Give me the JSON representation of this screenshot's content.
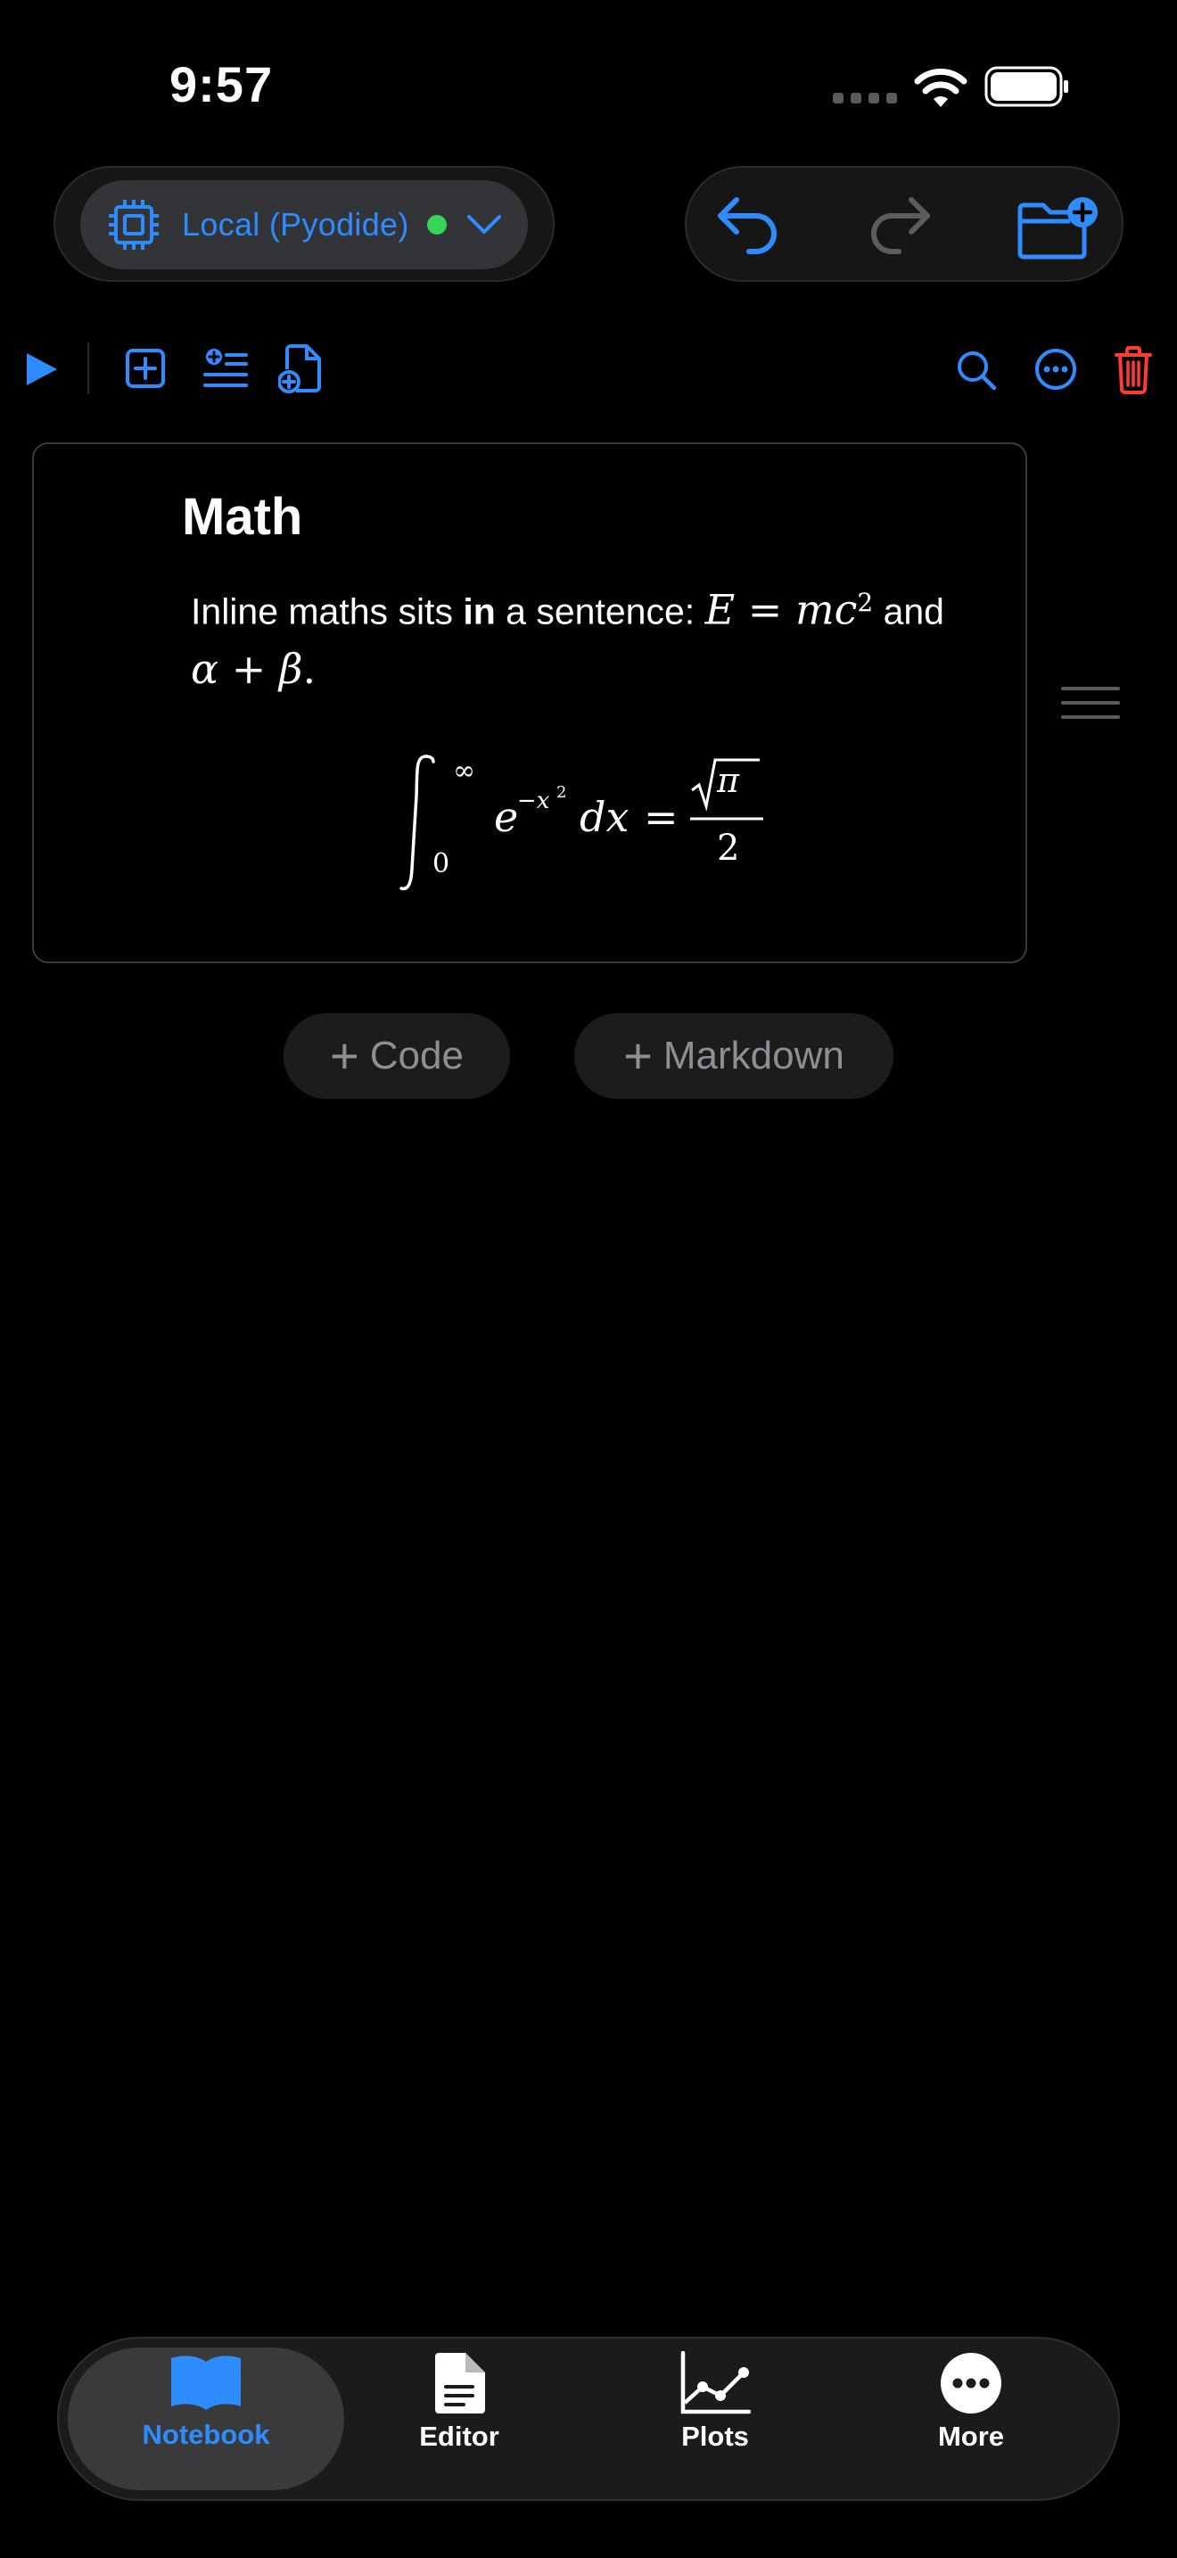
{
  "status_bar": {
    "time": "9:57"
  },
  "kernel": {
    "label": "Local (Pyodide)",
    "status_color": "#35d658"
  },
  "colors": {
    "accent": "#2f8cff",
    "danger": "#ff3b30",
    "disabled": "#5c5c5f"
  },
  "cell": {
    "title": "Math",
    "text_before": "Inline maths sits ",
    "text_bold": "in",
    "text_after": " a sentence: ",
    "formula_inline_1": "E = mc²",
    "text_and": " and",
    "formula_inline_2": "α + β.",
    "display_formula": "∫₀^∞ e^(−x²) dx = √π / 2"
  },
  "add_buttons": {
    "code": "Code",
    "markdown": "Markdown"
  },
  "tabs": [
    {
      "label": "Notebook",
      "icon": "book-icon",
      "active": true
    },
    {
      "label": "Editor",
      "icon": "document-icon",
      "active": false
    },
    {
      "label": "Plots",
      "icon": "chart-icon",
      "active": false
    },
    {
      "label": "More",
      "icon": "more-icon",
      "active": false
    }
  ]
}
